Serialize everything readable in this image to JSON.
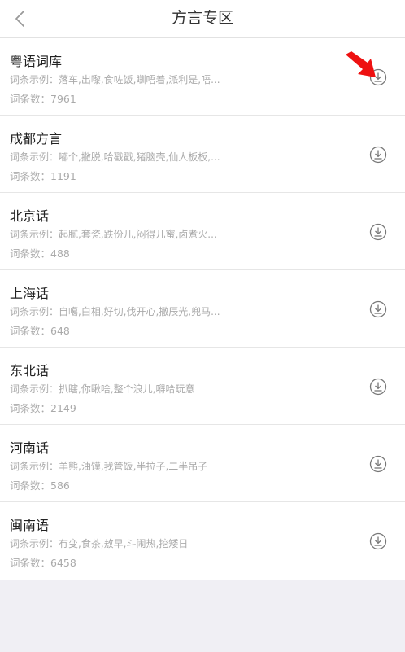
{
  "header": {
    "title": "方言专区",
    "back_icon": "chevron-left-icon"
  },
  "colors": {
    "background": "#f0eff4",
    "card": "#ffffff",
    "text_primary": "#222222",
    "text_secondary": "#aaaaaa",
    "icon_gray": "#777777",
    "annotation_red": "#ee1111"
  },
  "items": [
    {
      "name": "粤语词库",
      "example": "词条示例：落车,出嚟,食咗饭,瞓唔着,派利是,唔...",
      "count": "词条数：7961"
    },
    {
      "name": "成都方言",
      "example": "词条示例：嘟个,撇脱,哈戳戳,猪脑壳,仙人板板,...",
      "count": "词条数：1191"
    },
    {
      "name": "北京话",
      "example": "词条示例：起腻,套瓷,跌份儿,闷得儿蜜,卤煮火...",
      "count": "词条数：488"
    },
    {
      "name": "上海话",
      "example": "词条示例：自噶,白相,好切,伐开心,撒辰光,兜马...",
      "count": "词条数：648"
    },
    {
      "name": "东北话",
      "example": "词条示例：扒瞎,你瞅啥,整个浪儿,嘚哈玩意",
      "count": "词条数：2149"
    },
    {
      "name": "河南话",
      "example": "词条示例：羊熊,油馍,我管饭,半拉子,二半吊子",
      "count": "词条数：586"
    },
    {
      "name": "闽南语",
      "example": "词条示例：冇变,食茶,敖早,斗闹热,挖矮日",
      "count": "词条数：6458"
    }
  ]
}
